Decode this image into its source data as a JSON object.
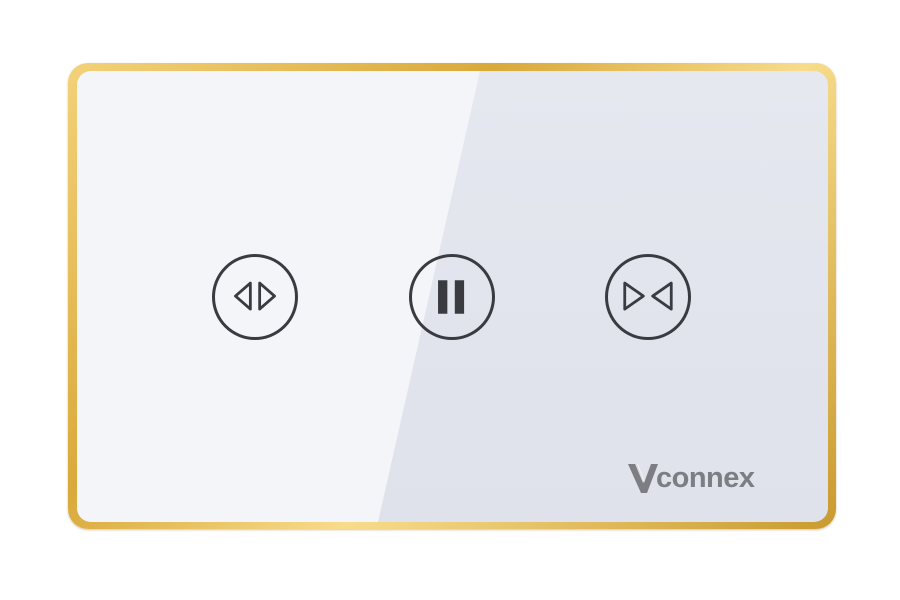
{
  "panel": {
    "frame_color": "#d9a93a",
    "glass_color": "#e2e4ec",
    "icon_color": "#3a3b40"
  },
  "buttons": [
    {
      "name": "curtain-open-button",
      "icon": "open-curtain-icon"
    },
    {
      "name": "curtain-pause-button",
      "icon": "pause-icon"
    },
    {
      "name": "curtain-close-button",
      "icon": "close-curtain-icon"
    }
  ],
  "brand": {
    "text": "connex",
    "logo_mark": "V",
    "color": "#7d7e84"
  }
}
